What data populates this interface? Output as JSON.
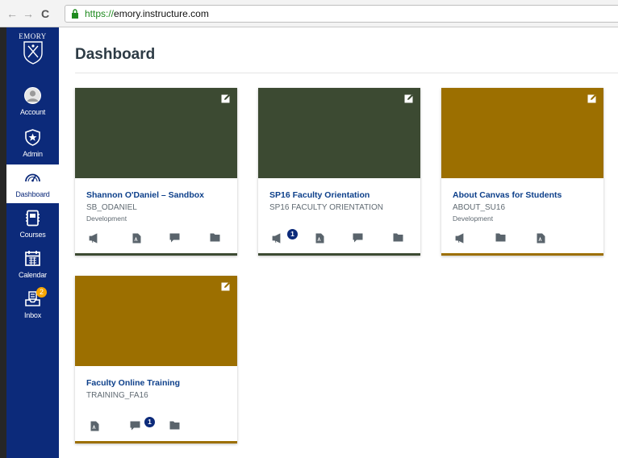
{
  "browser": {
    "url_scheme": "https://",
    "url_host": "emory.instructure.com",
    "back_icon": "arrow-left-icon",
    "forward_icon": "arrow-right-icon",
    "reload_icon": "reload-icon"
  },
  "sidebar": {
    "logo_text": "EMORY",
    "bg_color": "#0c2a7a",
    "items": [
      {
        "label": "Account",
        "icon": "user-icon"
      },
      {
        "label": "Admin",
        "icon": "shield-star-icon"
      },
      {
        "label": "Dashboard",
        "icon": "gauge-icon",
        "active": true
      },
      {
        "label": "Courses",
        "icon": "book-icon"
      },
      {
        "label": "Calendar",
        "icon": "calendar-icon"
      },
      {
        "label": "Inbox",
        "icon": "inbox-icon",
        "badge": "2"
      }
    ]
  },
  "main": {
    "title": "Dashboard"
  },
  "cards": [
    {
      "title": "Shannon O'Daniel – Sandbox",
      "code": "SB_ODANIEL",
      "term": "Development",
      "color": "#3c4a32",
      "icons": [
        "announcements-icon",
        "assignments-icon",
        "discussions-icon",
        "files-icon"
      ],
      "badges": {}
    },
    {
      "title": "SP16 Faculty Orientation",
      "code": "SP16 FACULTY ORIENTATION",
      "term": "",
      "color": "#3c4a32",
      "icons": [
        "announcements-icon",
        "assignments-icon",
        "discussions-icon",
        "files-icon"
      ],
      "badges": {
        "announcements": "1"
      }
    },
    {
      "title": "About Canvas for Students",
      "code": "ABOUT_SU16",
      "term": "Development",
      "color": "#9c6f00",
      "icons": [
        "announcements-icon",
        "files-icon",
        "assignments-icon"
      ],
      "badges": {}
    },
    {
      "title": "Faculty Online Training",
      "code": "TRAINING_FA16",
      "term": "",
      "color": "#9c6f00",
      "icons": [
        "assignments-icon",
        "discussions-icon",
        "files-icon"
      ],
      "badges": {
        "discussions": "1"
      }
    }
  ]
}
